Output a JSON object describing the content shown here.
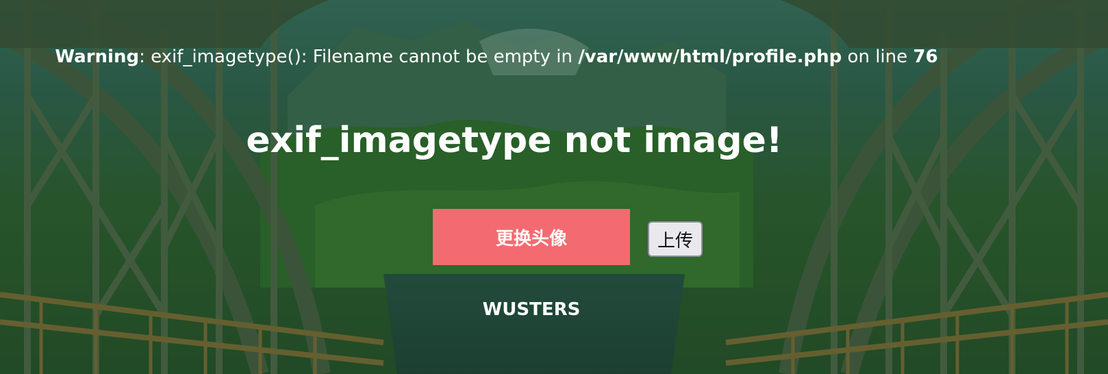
{
  "warning": {
    "label": "Warning",
    "text_before_path": ": exif_imagetype(): Filename cannot be empty in ",
    "file_path": "/var/www/html/profile.php",
    "text_before_line": " on line ",
    "line_number": "76"
  },
  "message": "exif_imagetype not image!",
  "buttons": {
    "change_avatar_label": "更换头像",
    "upload_label": "上传"
  },
  "username": "WUSTERS",
  "colors": {
    "accent_button": "#f36b70",
    "overlay_green": "#2f5a34",
    "text": "#ffffff"
  },
  "background": {
    "subject": "steel-bridge-mountain-lake-photo"
  }
}
